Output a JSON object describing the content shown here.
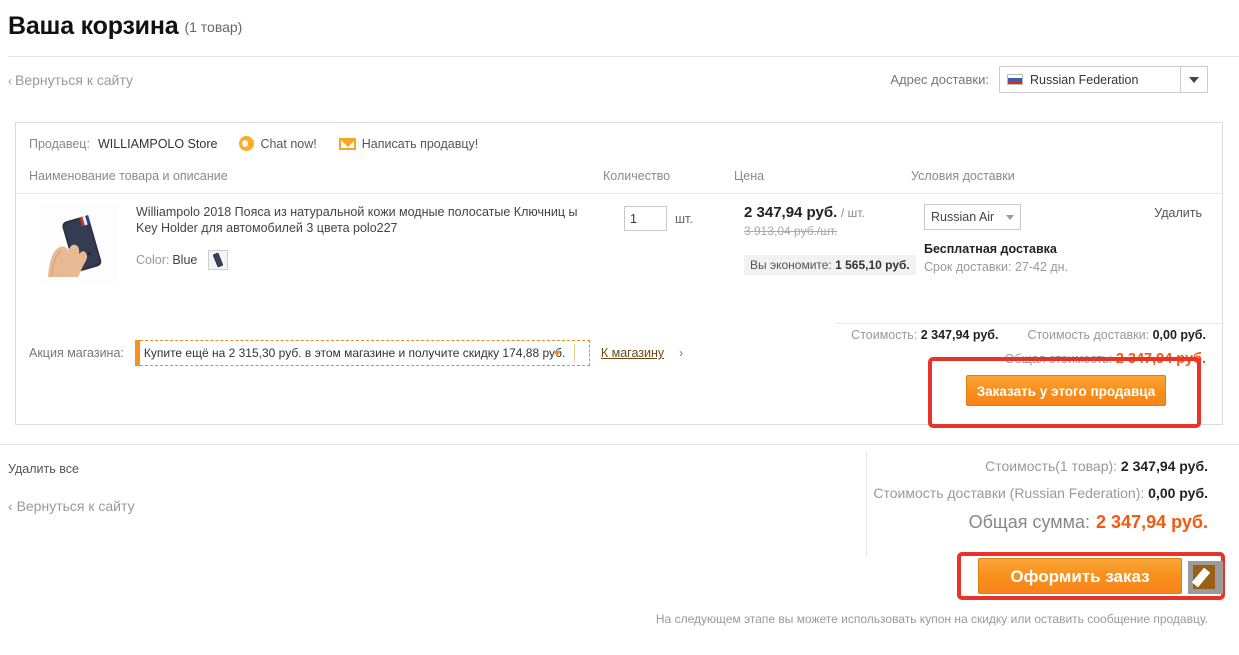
{
  "header": {
    "title": "Ваша корзина",
    "count_label": "(1 товар)",
    "back_link": "Вернуться к сайту",
    "back_chevron": "‹",
    "shipping_address_label": "Адрес доставки:",
    "shipping_country": "Russian Federation",
    "flag_icon": "russian-flag-icon",
    "dropdown_icon": "chevron-down-icon"
  },
  "card": {
    "seller": {
      "label": "Продавец:",
      "name": "WILLIAMPOLO Store",
      "chat_label": "Chat now!",
      "chat_icon": "chat-bubble-icon",
      "mail_label": "Написать продавцу!",
      "mail_icon": "envelope-icon"
    },
    "columns": {
      "name": "Наименование товара и описание",
      "quantity": "Количество",
      "price": "Цена",
      "shipping": "Условия доставки"
    },
    "product": {
      "thumb_alt": "product-thumbnail",
      "title": "Williampolo 2018 Пояса из натуральной кожи модные полосатые Ключниц ы Key Holder для автомобилей 3 цвета polo227",
      "attr_label": "Color:",
      "attr_value": "Blue",
      "swatch_name": "color-swatch-blue",
      "quantity_value": "1",
      "quantity_unit": "шт.",
      "price_current": "2 347,94 руб.",
      "price_per_unit": "/ шт.",
      "price_old": "3 913,04 руб./шт.",
      "save_label": "Вы экономите:",
      "save_value": "1 565,10 руб.",
      "shipping_method": "Russian Air",
      "free_shipping": "Бесплатная доставка",
      "delivery_time": "Срок доставки: 27-42 дн.",
      "delete_label": "Удалить"
    },
    "promo": {
      "label": "Акция магазина:",
      "text": "Купите ещё на 2 315,30 руб. в этом магазине и получите скидку 174,88 руб.",
      "caret_icon": "chevron-down-icon",
      "shop_link": "К магазину",
      "shop_chevron": "›"
    },
    "totals": {
      "cost_label": "Стоимость:",
      "cost_value": "2 347,94 руб.",
      "ship_label": "Стоимость доставки:",
      "ship_value": "0,00 руб.",
      "grand_label": "Общая стоимость:",
      "grand_value": "2 347,94 руб."
    },
    "order_button": "Заказать у этого продавца"
  },
  "bottom": {
    "delete_all": "Удалить все",
    "back_link": "Вернуться к сайту",
    "back_chevron": "‹",
    "summary_cost_label": "Стоимость(1 товар):",
    "summary_cost_value": "2 347,94 руб.",
    "summary_ship_label": "Стоимость доставки (Russian Federation):",
    "summary_ship_value": "0,00 руб.",
    "summary_total_label": "Общая сумма:",
    "summary_total_value": "2 347,94 руб.",
    "checkout_button": "Оформить заказ",
    "cursor_icon": "pencil-cursor-icon",
    "footer_note": "На следующем этапе вы можете использовать купон на скидку или оставить сообщение продавцу."
  },
  "colors": {
    "accent_orange": "#f25a12",
    "button_orange": "#f8901c",
    "highlight_red": "#e8332a",
    "promo_border": "#f08a1e"
  }
}
